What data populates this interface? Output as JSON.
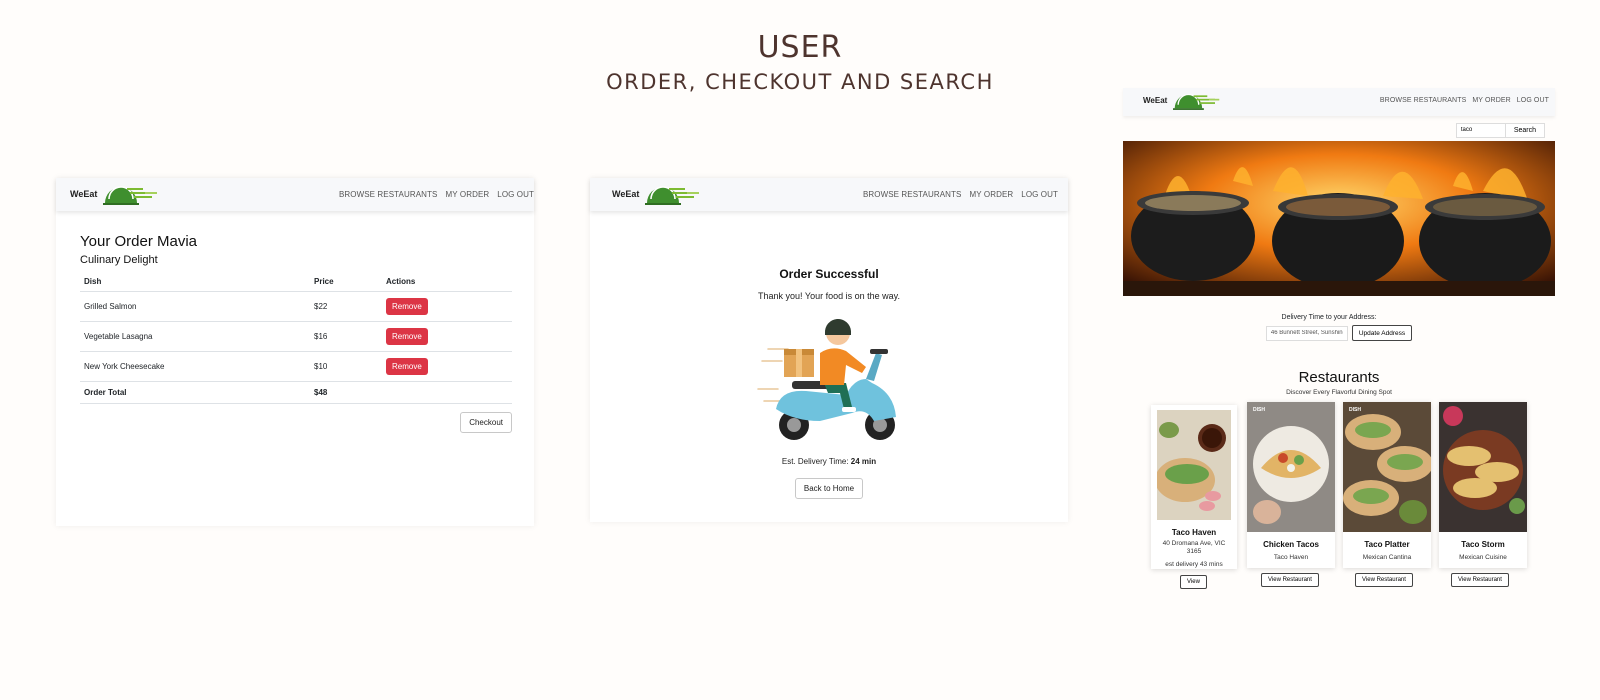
{
  "header": {
    "title": "USER",
    "subtitle": "ORDER, CHECKOUT AND SEARCH"
  },
  "nav": {
    "brand": "WeEat",
    "links": [
      "BROWSE RESTAURANTS",
      "MY ORDER",
      "LOG OUT"
    ]
  },
  "order": {
    "heading": "Your Order Mavia",
    "restaurant": "Culinary Delight",
    "columns": [
      "Dish",
      "Price",
      "Actions"
    ],
    "items": [
      {
        "dish": "Grilled Salmon",
        "price": "$22",
        "action": "Remove"
      },
      {
        "dish": "Vegetable Lasagna",
        "price": "$16",
        "action": "Remove"
      },
      {
        "dish": "New York Cheesecake",
        "price": "$10",
        "action": "Remove"
      }
    ],
    "total_label": "Order Total",
    "total_value": "$48",
    "checkout_label": "Checkout"
  },
  "success": {
    "title": "Order Successful",
    "message": "Thank you! Your food is on the way.",
    "eta_label": "Est. Delivery Time:",
    "eta_value": "24 min",
    "back_label": "Back to Home"
  },
  "search": {
    "query": "taco",
    "button": "Search",
    "delivery_label": "Delivery Time to your Address:",
    "address_value": "46 Bunnett Street, Sunshine",
    "update_label": "Update Address",
    "restaurants_title": "Restaurants",
    "restaurants_subtitle": "Discover Every Flavorful Dining Spot",
    "dish_tag": "DISH",
    "cards": [
      {
        "name": "Taco Haven",
        "line1": "40 Dromana Ave, VIC 3165",
        "line2": "est delivery 43 mins",
        "button": "View"
      },
      {
        "name": "Chicken Tacos",
        "line1": "Taco Haven",
        "button": "View Restaurant"
      },
      {
        "name": "Taco Platter",
        "line1": "Mexican Cantina",
        "button": "View Restaurant"
      },
      {
        "name": "Taco Storm",
        "line1": "Mexican Cuisine",
        "button": "View Restaurant"
      }
    ]
  },
  "colors": {
    "accent_brown": "#4e342e",
    "remove_red": "#dc3545",
    "logo_green": "#3f8f2e"
  }
}
